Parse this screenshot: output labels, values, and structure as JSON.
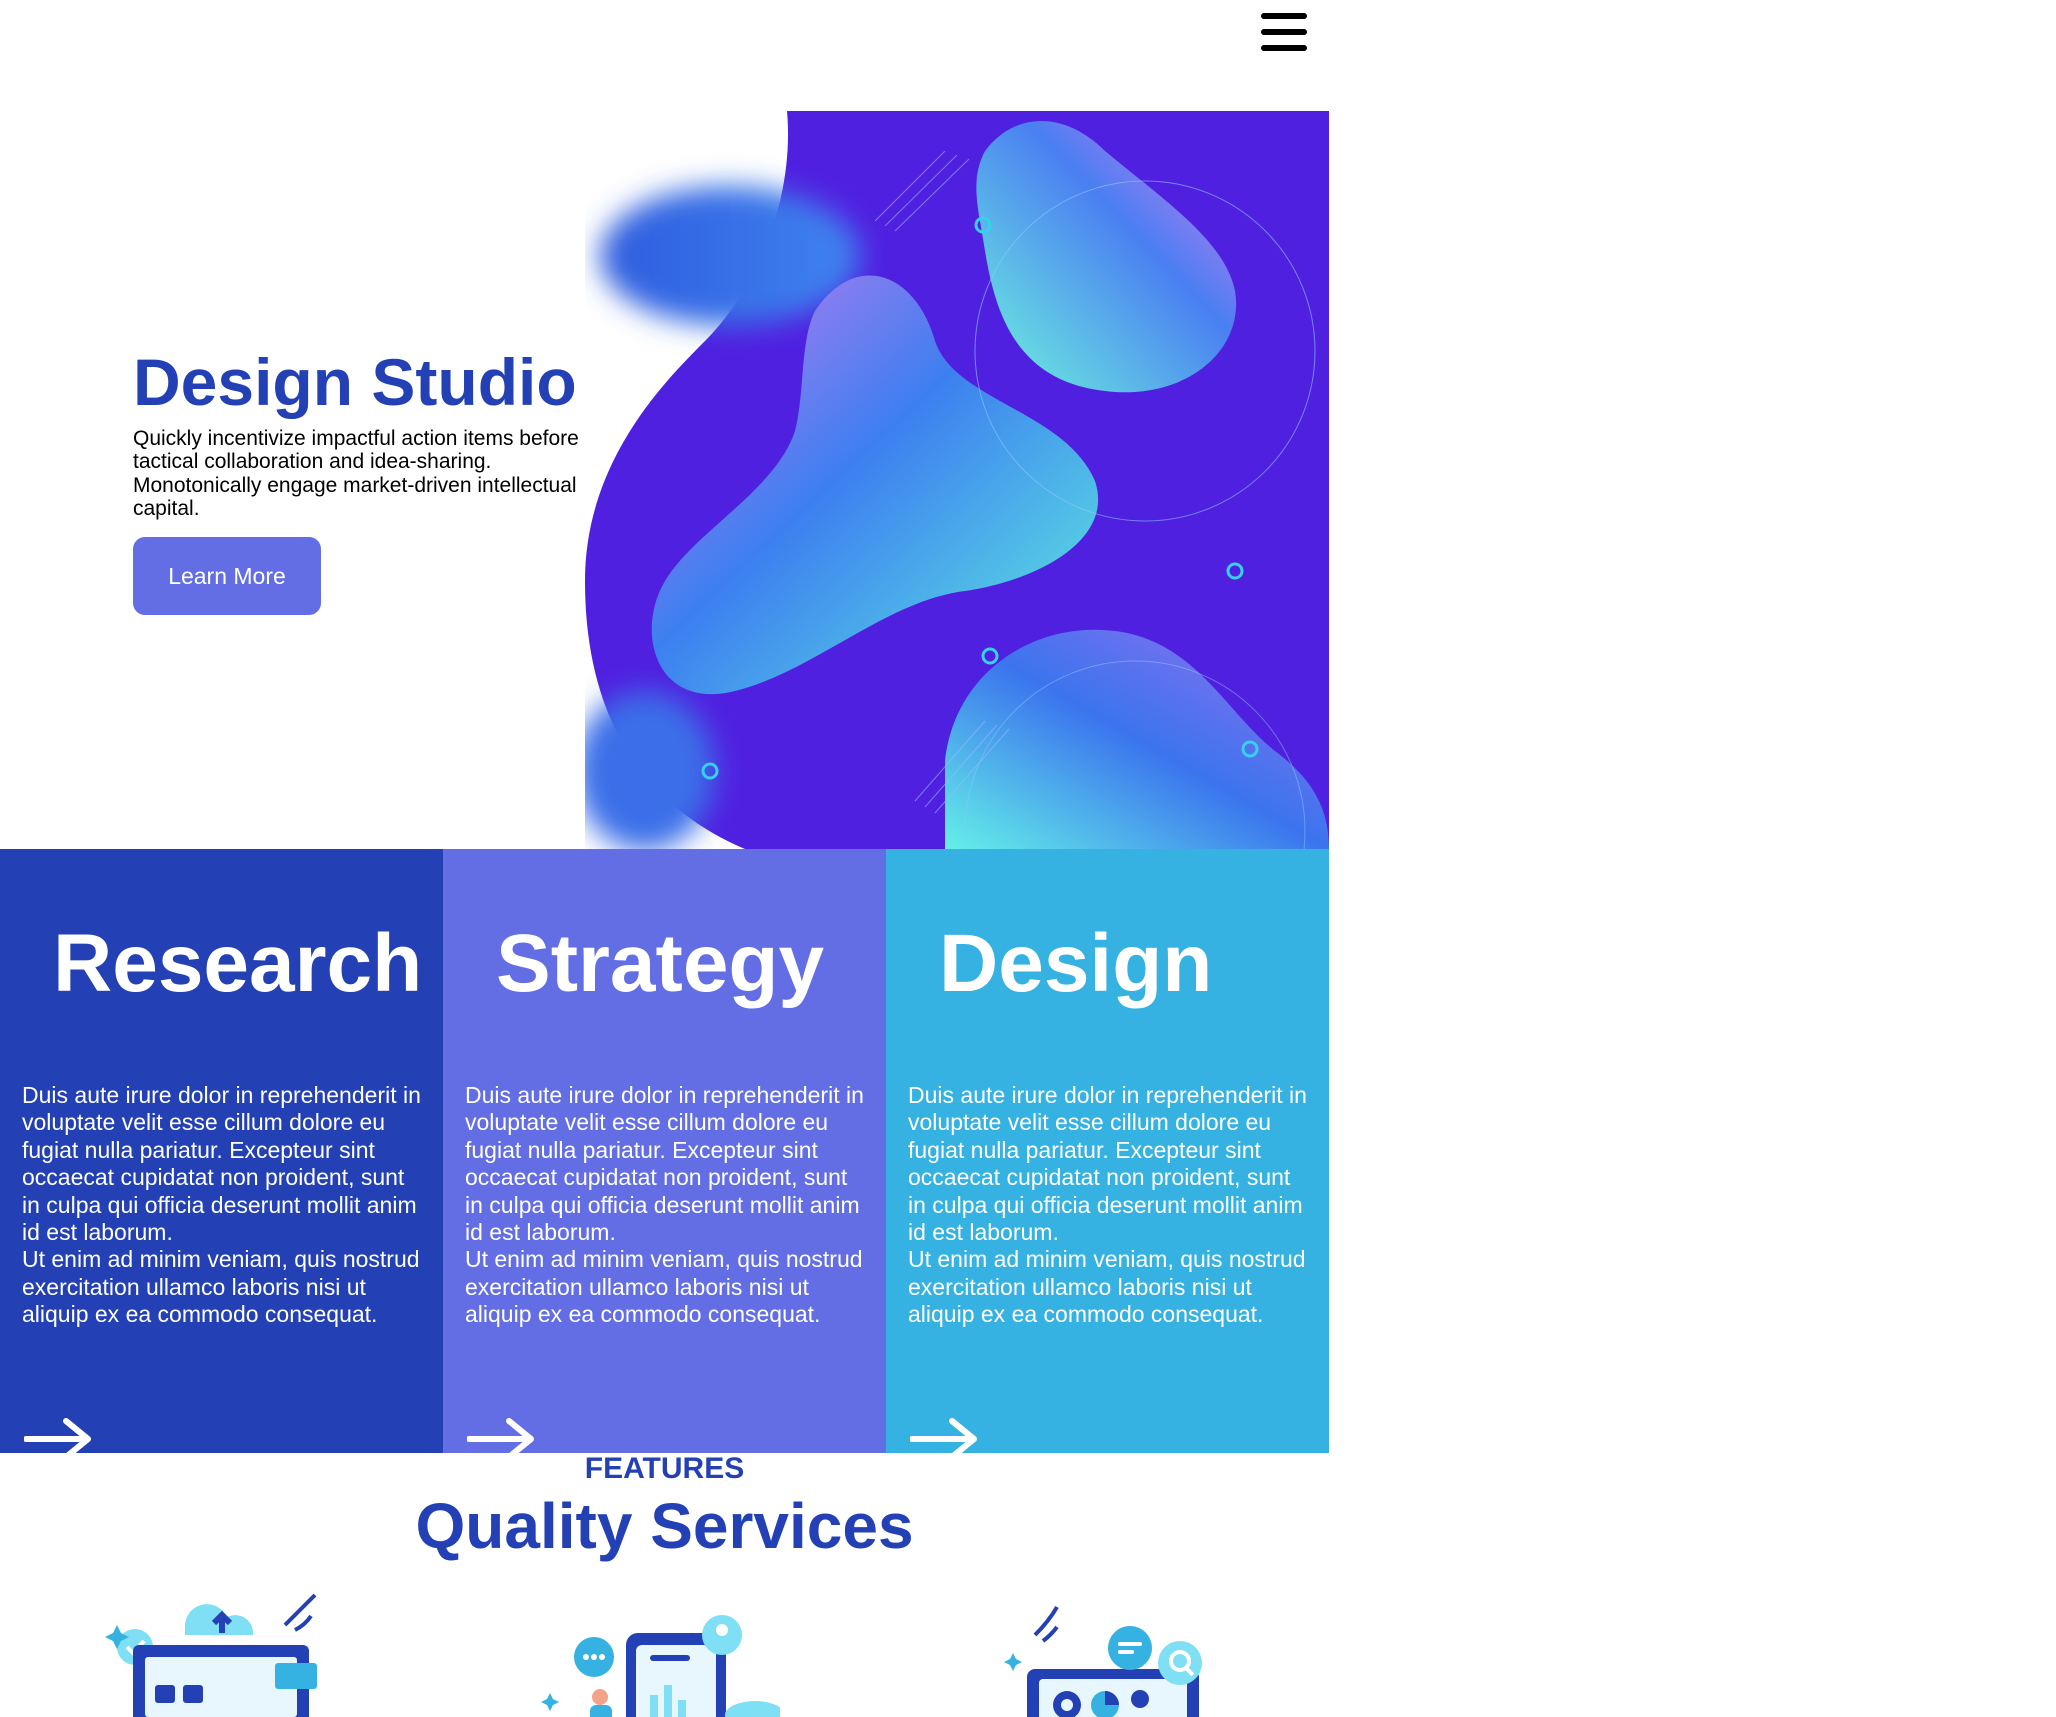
{
  "nav": {
    "menu_icon": "hamburger-menu-icon"
  },
  "hero": {
    "title": "Design Studio",
    "description": "Quickly incentivize impactful action items before tactical collaboration and idea-sharing. Monotonically engage market-driven intellectual capital.",
    "button_label": "Learn More",
    "art_icon": "fluid-abstract-blob-illustration"
  },
  "cards": [
    {
      "title": "Research",
      "paragraph1": "Duis aute irure dolor in reprehenderit in voluptate velit esse cillum dolore eu fugiat nulla pariatur. Excepteur sint occaecat cupidatat non proident, sunt in culpa qui officia deserunt mollit anim id est laborum.",
      "paragraph2": "Ut enim ad minim veniam, quis nostrud exercitation ullamco laboris nisi ut aliquip ex ea commodo consequat.",
      "arrow_icon": "arrow-right-icon",
      "color": "#2341b4"
    },
    {
      "title": "Strategy",
      "paragraph1": "Duis aute irure dolor in reprehenderit in voluptate velit esse cillum dolore eu fugiat nulla pariatur. Excepteur sint occaecat cupidatat non proident, sunt in culpa qui officia deserunt mollit anim id est laborum.",
      "paragraph2": "Ut enim ad minim veniam, quis nostrud exercitation ullamco laboris nisi ut aliquip ex ea commodo consequat.",
      "arrow_icon": "arrow-right-icon",
      "color": "#636ee5"
    },
    {
      "title": "Design",
      "paragraph1": "Duis aute irure dolor in reprehenderit in voluptate velit esse cillum dolore eu fugiat nulla pariatur. Excepteur sint occaecat cupidatat non proident, sunt in culpa qui officia deserunt mollit anim id est laborum.",
      "paragraph2": "Ut enim ad minim veniam, quis nostrud exercitation ullamco laboris nisi ut aliquip ex ea commodo consequat.",
      "arrow_icon": "arrow-right-icon",
      "color": "#36b2e2"
    }
  ],
  "features": {
    "label": "FEATURES",
    "title": "Quality Services",
    "illustrations": [
      "cloud-upload-dashboard-illustration",
      "mobile-chat-analytics-illustration",
      "search-analytics-monitor-illustration"
    ]
  },
  "colors": {
    "primary": "#2341b4",
    "accent": "#636ee5",
    "sky": "#36b2e2",
    "hero_bg": "#5020e0"
  }
}
